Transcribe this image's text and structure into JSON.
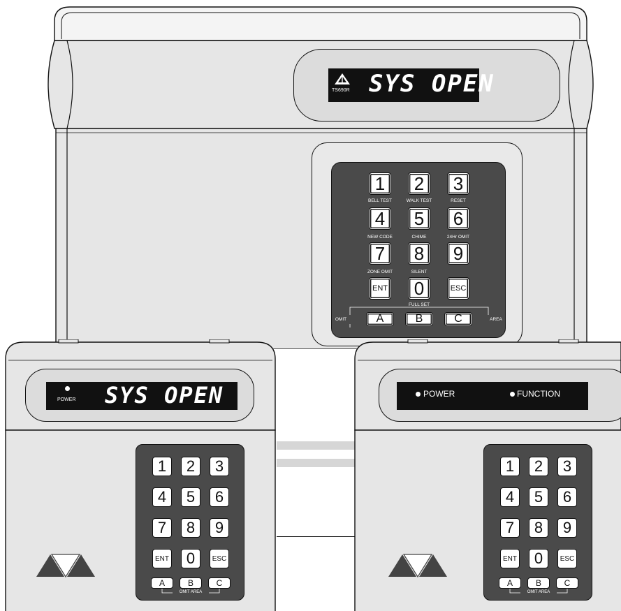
{
  "main_panel": {
    "model": "TS690R",
    "display_text": "SYS OPEN",
    "keys": [
      {
        "label": "1",
        "caption": "BELL TEST"
      },
      {
        "label": "2",
        "caption": "WALK TEST"
      },
      {
        "label": "3",
        "caption": "RESET"
      },
      {
        "label": "4",
        "caption": "NEW CODE"
      },
      {
        "label": "5",
        "caption": "CHIME"
      },
      {
        "label": "6",
        "caption": "24Hr OMIT"
      },
      {
        "label": "7",
        "caption": "ZONE OMIT"
      },
      {
        "label": "8",
        "caption": "SILENT"
      },
      {
        "label": "9",
        "caption": ""
      },
      {
        "label": "ENT",
        "caption": ""
      },
      {
        "label": "0",
        "caption": ""
      },
      {
        "label": "ESC",
        "caption": ""
      }
    ],
    "area_keys": [
      "A",
      "B",
      "C"
    ],
    "area_labels": {
      "left": "OMIT",
      "center": "FULL SET",
      "right": "AREA"
    }
  },
  "left_keypad": {
    "power_label": "POWER",
    "display_text": "SYS OPEN",
    "keys": [
      "1",
      "2",
      "3",
      "4",
      "5",
      "6",
      "7",
      "8",
      "9",
      "ENT",
      "0",
      "ESC"
    ],
    "area_keys": [
      "A",
      "B",
      "C"
    ],
    "area_caption": "OMIT AREA"
  },
  "right_keypad": {
    "power_label": "POWER",
    "function_label": "FUNCTION",
    "keys": [
      "1",
      "2",
      "3",
      "4",
      "5",
      "6",
      "7",
      "8",
      "9",
      "ENT",
      "0",
      "ESC"
    ],
    "area_keys": [
      "A",
      "B",
      "C"
    ],
    "area_caption": "OMIT AREA"
  },
  "colors": {
    "outline": "#111111",
    "panel": "#e8e8e8",
    "keypad": "#4a4a4a",
    "display": "#111111"
  }
}
